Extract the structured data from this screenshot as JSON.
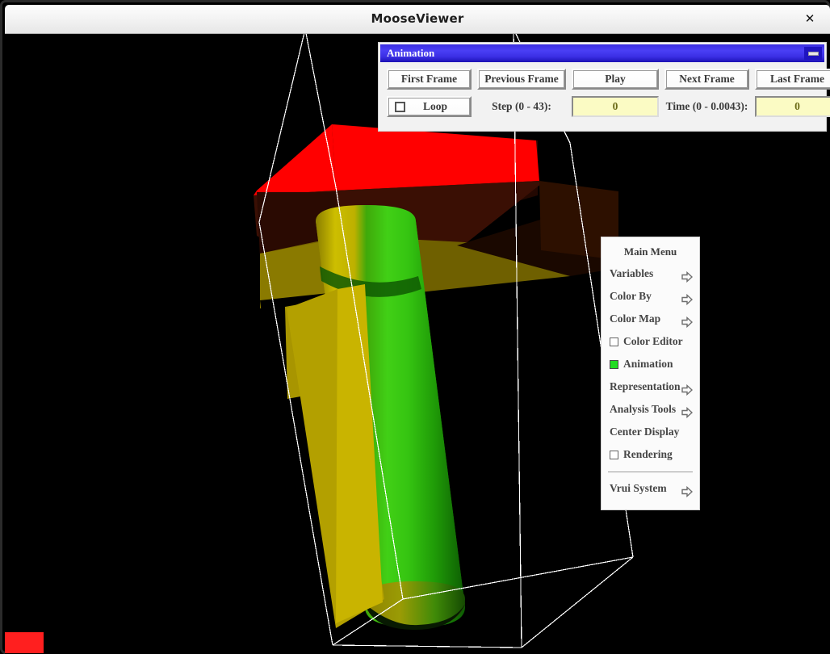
{
  "window": {
    "title": "MooseViewer",
    "close_label": "✕",
    "close_icon": "close-icon"
  },
  "animation_dialog": {
    "title": "Animation",
    "minimize_icon": "minimize-icon",
    "buttons": [
      {
        "id": "first",
        "label": "First Frame"
      },
      {
        "id": "prev",
        "label": "Previous Frame"
      },
      {
        "id": "play",
        "label": "Play"
      },
      {
        "id": "next",
        "label": "Next Frame"
      },
      {
        "id": "last",
        "label": "Last Frame"
      }
    ],
    "loop": {
      "label": "Loop",
      "checked": false
    },
    "step": {
      "label": "Step (0 - 43):",
      "value": "0",
      "min": 0,
      "max": 43
    },
    "time": {
      "label": "Time (0 - 0.0043):",
      "value": "0",
      "min": 0,
      "max": 0.0043
    }
  },
  "main_menu": {
    "title": "Main Menu",
    "items": [
      {
        "label": "Variables",
        "type": "submenu"
      },
      {
        "label": "Color By",
        "type": "submenu"
      },
      {
        "label": "Color Map",
        "type": "submenu"
      },
      {
        "label": "Color Editor",
        "type": "checkbox",
        "checked": false
      },
      {
        "label": "Animation",
        "type": "checkbox",
        "checked": true
      },
      {
        "label": "Representation",
        "type": "submenu"
      },
      {
        "label": "Analysis Tools",
        "type": "submenu"
      },
      {
        "label": "Center Display",
        "type": "action"
      },
      {
        "label": "Rendering",
        "type": "checkbox",
        "checked": false
      }
    ],
    "footer_items": [
      {
        "label": "Vrui System",
        "type": "submenu"
      }
    ]
  },
  "viewport": {
    "background_color": "#000000",
    "wireframe_color": "#ffffff",
    "corner_marker_color": "#ff1f1f",
    "cylinder_colors": [
      "#cfc400",
      "#2fc412",
      "#18a008"
    ],
    "box_top_color": "#ff0000",
    "scene_description": "3D volume rendering: red-capped dark prism and a green-to-yellow colored cylinder inside a white wireframe bounding box"
  },
  "colors": {
    "dialog_title_blue": "#3b2fe0",
    "field_yellow": "#fbfbc4",
    "toggle_green": "#22dd22",
    "accent_red": "#ff1f1f"
  }
}
